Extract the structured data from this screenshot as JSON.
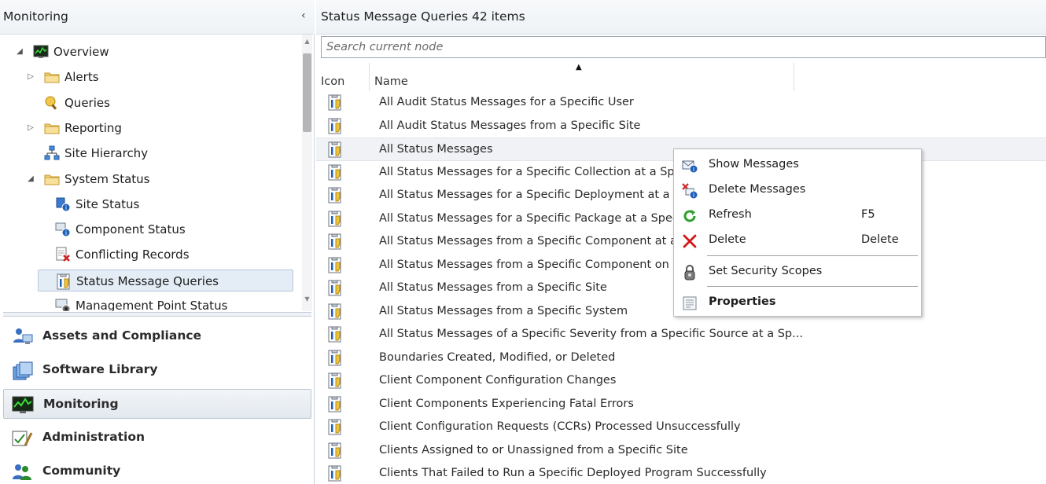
{
  "left_pane": {
    "title": "Monitoring",
    "collapse_glyph": "‹",
    "tree": [
      {
        "label": "Overview",
        "icon": "overview-monitor-icon",
        "arrow": "◢",
        "indent": 0
      },
      {
        "label": "Alerts",
        "icon": "folder-icon",
        "arrow": "▷",
        "indent": 1
      },
      {
        "label": "Queries",
        "icon": "queries-icon",
        "arrow": "",
        "indent": 1
      },
      {
        "label": "Reporting",
        "icon": "folder-icon",
        "arrow": "▷",
        "indent": 1
      },
      {
        "label": "Site Hierarchy",
        "icon": "site-hierarchy-icon",
        "arrow": "",
        "indent": 1
      },
      {
        "label": "System Status",
        "icon": "folder-icon",
        "arrow": "◢",
        "indent": 1
      },
      {
        "label": "Site Status",
        "icon": "site-status-icon",
        "arrow": "",
        "indent": 2
      },
      {
        "label": "Component Status",
        "icon": "component-status-icon",
        "arrow": "",
        "indent": 2
      },
      {
        "label": "Conflicting Records",
        "icon": "conflicting-records-icon",
        "arrow": "",
        "indent": 2
      },
      {
        "label": "Status Message Queries",
        "icon": "status-message-query-icon",
        "arrow": "",
        "indent": 2,
        "selected": true
      },
      {
        "label": "Management Point Status",
        "icon": "management-point-status-icon",
        "arrow": "",
        "indent": 2
      }
    ],
    "workspaces": [
      {
        "label": "Assets and Compliance",
        "icon": "assets-compliance-icon"
      },
      {
        "label": "Software Library",
        "icon": "software-library-icon"
      },
      {
        "label": "Monitoring",
        "icon": "monitoring-icon",
        "active": true
      },
      {
        "label": "Administration",
        "icon": "administration-icon"
      },
      {
        "label": "Community",
        "icon": "community-icon"
      }
    ]
  },
  "right_pane": {
    "title": "Status Message Queries 42 items",
    "search_placeholder": "Search current node",
    "columns": [
      "Icon",
      "Name"
    ],
    "sort_glyph": "▲",
    "rows": [
      "All Audit Status Messages for a Specific User",
      "All Audit Status Messages from a Specific Site",
      "All Status Messages",
      "All Status Messages for a Specific Collection at a Spe",
      "All Status Messages for a Specific Deployment at a S",
      "All Status Messages for a Specific Package at a Speci",
      "All Status Messages from a Specific Component at a",
      "All Status Messages from a Specific Component on a",
      "All Status Messages from a Specific Site",
      "All Status Messages from a Specific System",
      "All Status Messages of a Specific Severity from a Specific Source at a Sp...",
      "Boundaries Created, Modified, or Deleted",
      "Client Component Configuration Changes",
      "Client Components Experiencing Fatal Errors",
      "Client Configuration Requests (CCRs) Processed Unsuccessfully",
      "Clients Assigned to or Unassigned from a Specific Site",
      "Clients That Failed to Run a Specific Deployed Program Successfully"
    ],
    "selected_row": 2
  },
  "context_menu": {
    "items": [
      {
        "label": "Show Messages",
        "icon": "show-messages-icon",
        "shortcut": ""
      },
      {
        "label": "Delete Messages",
        "icon": "delete-messages-icon",
        "shortcut": ""
      },
      {
        "label": "Refresh",
        "icon": "refresh-icon",
        "shortcut": "F5"
      },
      {
        "label": "Delete",
        "icon": "delete-icon",
        "shortcut": "Delete"
      },
      {
        "label": "Set Security Scopes",
        "icon": "security-scopes-icon",
        "shortcut": ""
      },
      {
        "label": "Properties",
        "icon": "properties-icon",
        "shortcut": "",
        "bold": true
      }
    ]
  }
}
